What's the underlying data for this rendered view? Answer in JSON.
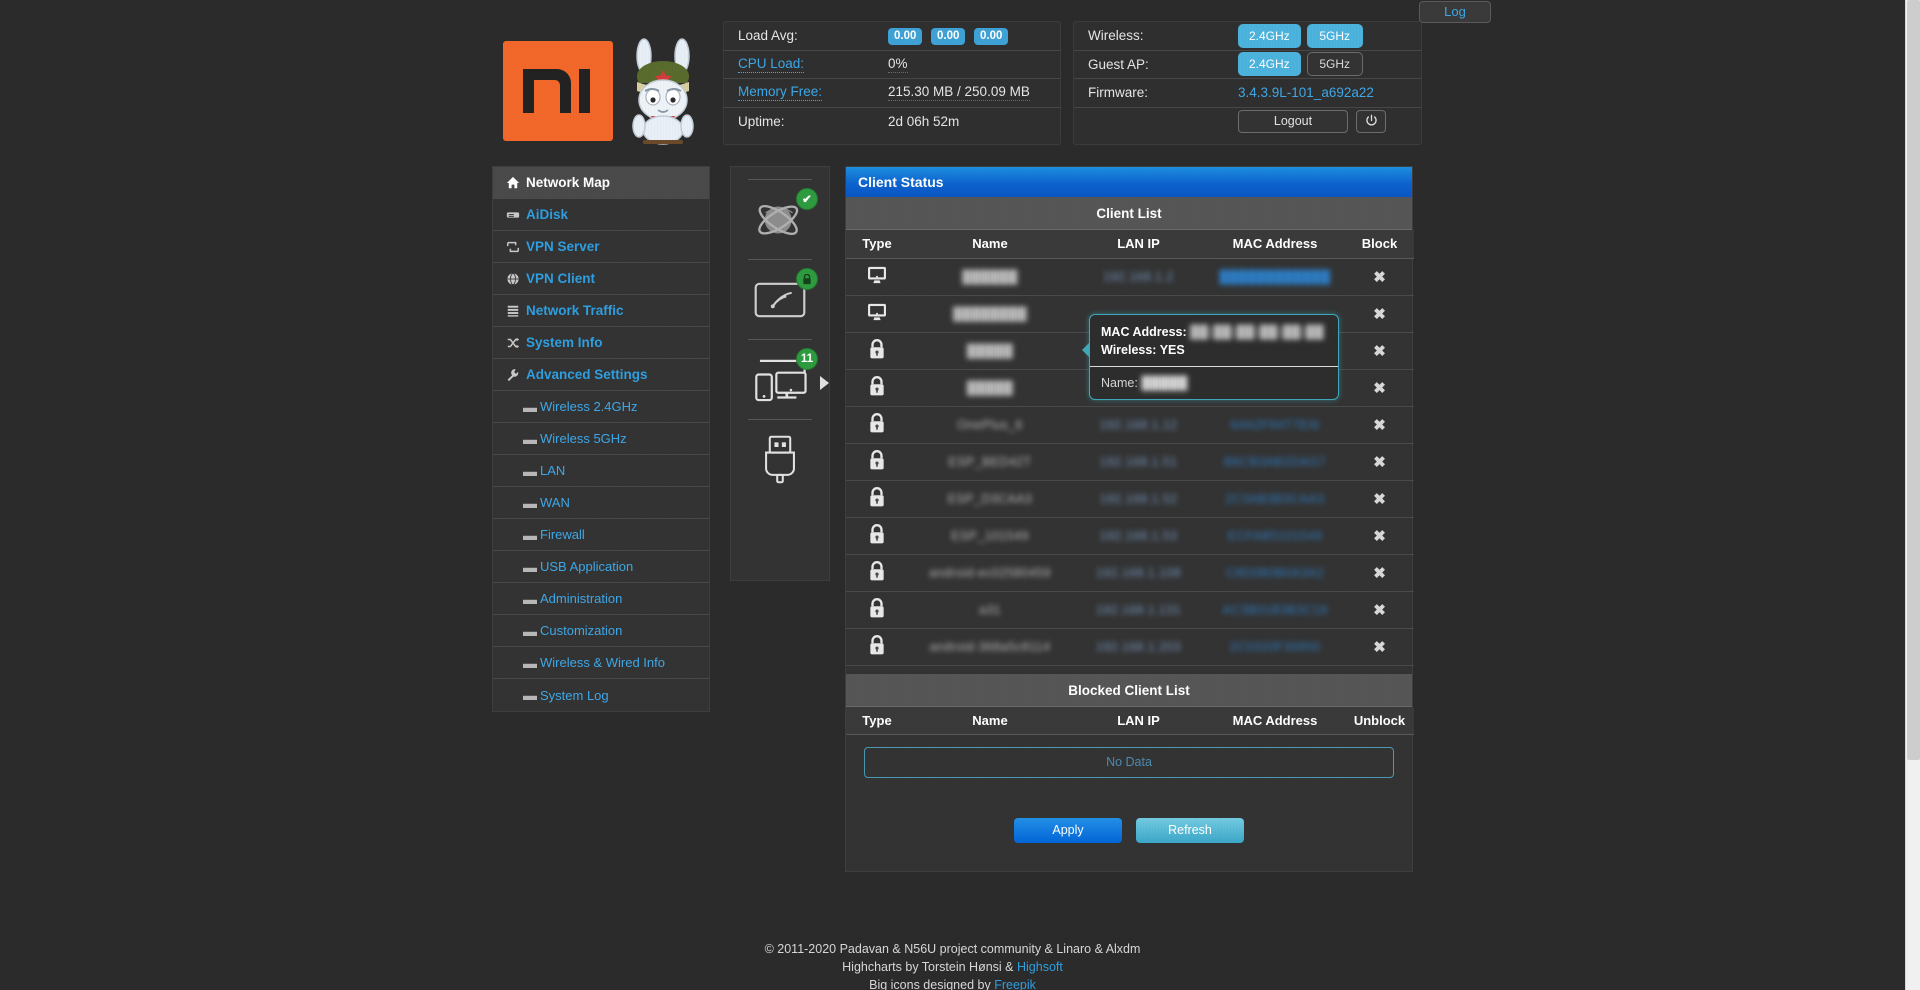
{
  "topbar": {
    "log_label": "Log"
  },
  "branding": {
    "logo_alt": "mi-logo",
    "mascot_alt": "mitu-rabbit"
  },
  "system_status": {
    "rows": [
      {
        "label": "Load Avg:",
        "type": "badges",
        "values": [
          "0.00",
          "0.00",
          "0.00"
        ]
      },
      {
        "label": "CPU Load:",
        "type": "text",
        "value": "0%",
        "label_link": true,
        "value_dotted": true
      },
      {
        "label": "Memory Free:",
        "type": "text",
        "value": "215.30 MB / 250.09 MB",
        "label_link": true,
        "value_dotted": true
      },
      {
        "label": "Uptime:",
        "type": "text",
        "value": "2d 06h 52m"
      }
    ]
  },
  "wireless_status": {
    "wireless_label": "Wireless:",
    "wireless_bands": [
      {
        "label": "2.4GHz",
        "state": "on"
      },
      {
        "label": "5GHz",
        "state": "on"
      }
    ],
    "guest_label": "Guest AP:",
    "guest_bands": [
      {
        "label": "2.4GHz",
        "state": "on"
      },
      {
        "label": "5GHz",
        "state": "off"
      }
    ],
    "firmware_label": "Firmware:",
    "firmware_value": "3.4.3.9L-101_a692a22",
    "logout_label": "Logout",
    "power_icon": "power-icon"
  },
  "sidebar": {
    "items": [
      {
        "label": "Network Map",
        "icon": "home-icon",
        "active": true,
        "sub": false
      },
      {
        "label": "AiDisk",
        "icon": "disk-icon",
        "active": false,
        "sub": false
      },
      {
        "label": "VPN Server",
        "icon": "vpn-server-icon",
        "active": false,
        "sub": false
      },
      {
        "label": "VPN Client",
        "icon": "globe-icon",
        "active": false,
        "sub": false
      },
      {
        "label": "Network Traffic",
        "icon": "list-icon",
        "active": false,
        "sub": false
      },
      {
        "label": "System Info",
        "icon": "shuffle-icon",
        "active": false,
        "sub": false
      },
      {
        "label": "Advanced Settings",
        "icon": "wrench-icon",
        "active": false,
        "sub": false
      },
      {
        "label": "Wireless 2.4GHz",
        "icon": "dash-icon",
        "active": false,
        "sub": true
      },
      {
        "label": "Wireless 5GHz",
        "icon": "dash-icon",
        "active": false,
        "sub": true
      },
      {
        "label": "LAN",
        "icon": "dash-icon",
        "active": false,
        "sub": true
      },
      {
        "label": "WAN",
        "icon": "dash-icon",
        "active": false,
        "sub": true
      },
      {
        "label": "Firewall",
        "icon": "dash-icon",
        "active": false,
        "sub": true
      },
      {
        "label": "USB Application",
        "icon": "dash-icon",
        "active": false,
        "sub": true
      },
      {
        "label": "Administration",
        "icon": "dash-icon",
        "active": false,
        "sub": true
      },
      {
        "label": "Customization",
        "icon": "dash-icon",
        "active": false,
        "sub": true
      },
      {
        "label": "Wireless & Wired Info",
        "icon": "dash-icon",
        "active": false,
        "sub": true
      },
      {
        "label": "System Log",
        "icon": "dash-icon",
        "active": false,
        "sub": true
      }
    ]
  },
  "network_map": {
    "cells": [
      {
        "icon": "internet-globe-icon",
        "badge": "check",
        "badge_text": "✔"
      },
      {
        "icon": "wireless-router-icon",
        "badge": "lock",
        "badge_text": ""
      },
      {
        "icon": "clients-devices-icon",
        "badge": "count",
        "badge_text": "11",
        "selected": true
      },
      {
        "icon": "usb-icon",
        "badge": null,
        "badge_text": ""
      }
    ]
  },
  "client_status": {
    "panel_title": "Client Status",
    "client_list_heading": "Client List",
    "columns": [
      "Type",
      "Name",
      "LAN IP",
      "MAC Address",
      "Block"
    ],
    "block_icon": "✖",
    "clients": [
      {
        "type": "wired",
        "name": "██████",
        "ip": "192.168.1.2",
        "mac": "████████████",
        "redacted": true
      },
      {
        "type": "wired",
        "name": "████████",
        "ip": "",
        "mac": "",
        "redacted": true
      },
      {
        "type": "wireless",
        "name": "█████",
        "ip": "",
        "mac": "",
        "redacted": true
      },
      {
        "type": "wireless",
        "name": "█████",
        "ip": "",
        "mac": "",
        "redacted": true
      },
      {
        "type": "wireless",
        "name": "OnePlus_6",
        "ip": "192.168.1.12",
        "mac": "64A2F94T7EI6",
        "redacted": true
      },
      {
        "type": "wireless",
        "name": "ESP_BED42T",
        "ip": "192.168.1.51",
        "mac": "B6CB3AB2DAG7",
        "redacted": true
      },
      {
        "type": "wireless",
        "name": "ESP_D3CAA3",
        "ip": "192.168.1.52",
        "mac": "2C3AB3B3CAA3",
        "redacted": true
      },
      {
        "type": "wireless",
        "name": "ESP_101549",
        "ip": "192.168.1.53",
        "mac": "ECFAB5101549",
        "redacted": true
      },
      {
        "type": "wireless",
        "name": "android-ec02580459",
        "ip": "192.168.1.108",
        "mac": "C8D0B0B0A3A2",
        "redacted": true
      },
      {
        "type": "wireless",
        "name": "a31",
        "ip": "192.168.1.131",
        "mac": "AC3B01B3B3C19",
        "redacted": true
      },
      {
        "type": "wireless",
        "name": "android-368a5c8114",
        "ip": "192.168.1.203",
        "mac": "2C0320F30950",
        "redacted": true
      }
    ],
    "blocked_list_heading": "Blocked Client List",
    "blocked_columns": [
      "Type",
      "Name",
      "LAN IP",
      "MAC Address",
      "Unblock"
    ],
    "blocked_empty_text": "No Data",
    "apply_label": "Apply",
    "refresh_label": "Refresh"
  },
  "tooltip": {
    "mac_label": "MAC Address:",
    "mac_value": "██:██:██:██:██:██",
    "wireless_label": "Wireless:",
    "wireless_value": "YES",
    "name_label": "Name:",
    "name_value": "█████"
  },
  "footer": {
    "line1": "© 2011-2020 Padavan & N56U project community & Linaro & Alxdm",
    "line2_pre": "Highcharts by Torstein Hønsi & ",
    "line2_link": "Highsoft",
    "line3_pre": "Big icons designed by ",
    "line3_link": "Freepik"
  },
  "colors": {
    "accent_blue": "#2e9fe0",
    "panel_header": "#0d63cf",
    "badge_green": "#2e9b3f",
    "mi_orange": "#f2682a",
    "pill_on": "#4cb3dd"
  }
}
